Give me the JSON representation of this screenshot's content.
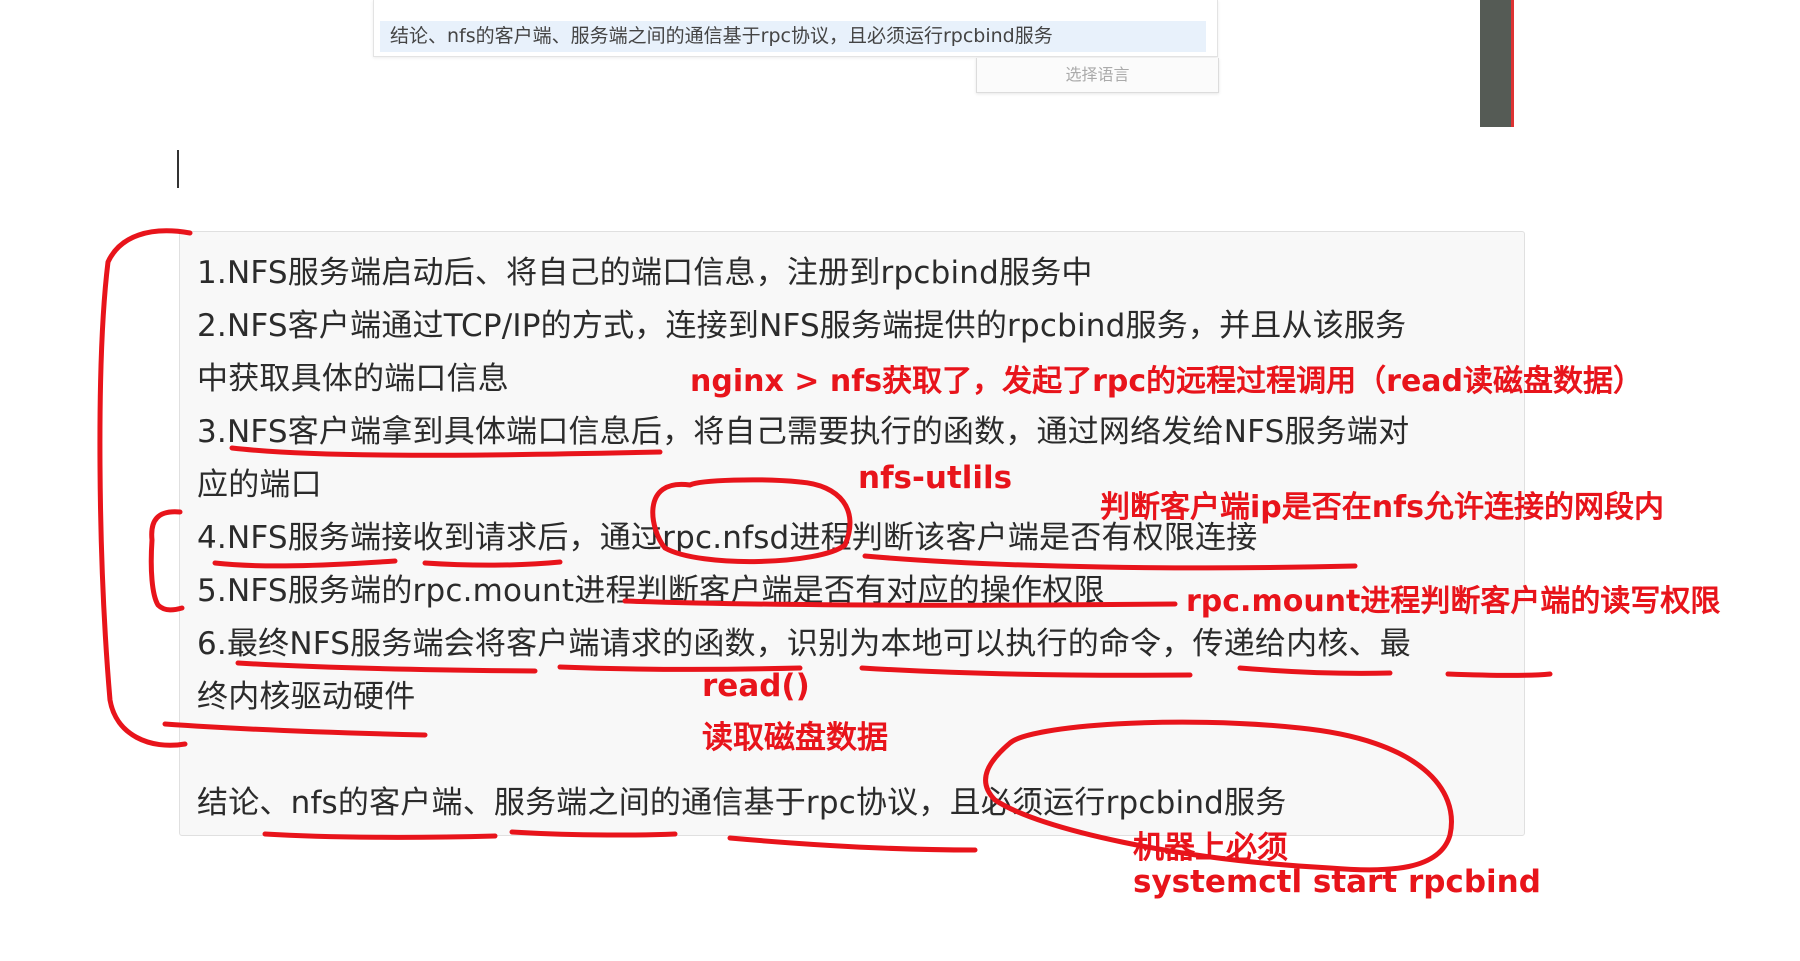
{
  "translate_popup": {
    "text": "结论、nfs的客户端、服务端之间的通信基于rpc协议，且必须运行rpcbind服务",
    "language_button": "选择语言"
  },
  "content": {
    "lines": [
      "1.NFS服务端启动后、将自己的端口信息，注册到rpcbind服务中",
      "2.NFS客户端通过TCP/IP的方式，连接到NFS服务端提供的rpcbind服务，并且从该服务",
      "中获取具体的端口信息",
      "3.NFS客户端拿到具体端口信息后，将自己需要执行的函数，通过网络发给NFS服务端对",
      "应的端口",
      "4.NFS服务端接收到请求后，通过rpc.nfsd进程判断该客户端是否有权限连接",
      "5.NFS服务端的rpc.mount进程判断客户端是否有对应的操作权限",
      "6.最终NFS服务端会将客户端请求的函数，识别为本地可以执行的命令，传递给内核、最",
      "终内核驱动硬件"
    ],
    "conclusion": "结论、nfs的客户端、服务端之间的通信基于rpc协议，且必须运行rpcbind服务"
  },
  "annotations": {
    "nginx_rpc": "nginx > nfs获取了，发起了rpc的远程过程调用（read读磁盘数据）",
    "nfs_utils": "nfs-utlils",
    "ip_check": "判断客户端ip是否在nfs允许连接的网段内",
    "rpc_mount_perm": "rpc.mount进程判断客户端的读写权限",
    "read_call": "read()",
    "read_disk": "读取磁盘数据",
    "machine_must": "机器上必须",
    "systemctl": "systemctl start rpcbind"
  },
  "colors": {
    "annotation_red": "#e8141b",
    "popup_highlight": "#e8f1fb",
    "content_bg": "#f8f8f8"
  }
}
